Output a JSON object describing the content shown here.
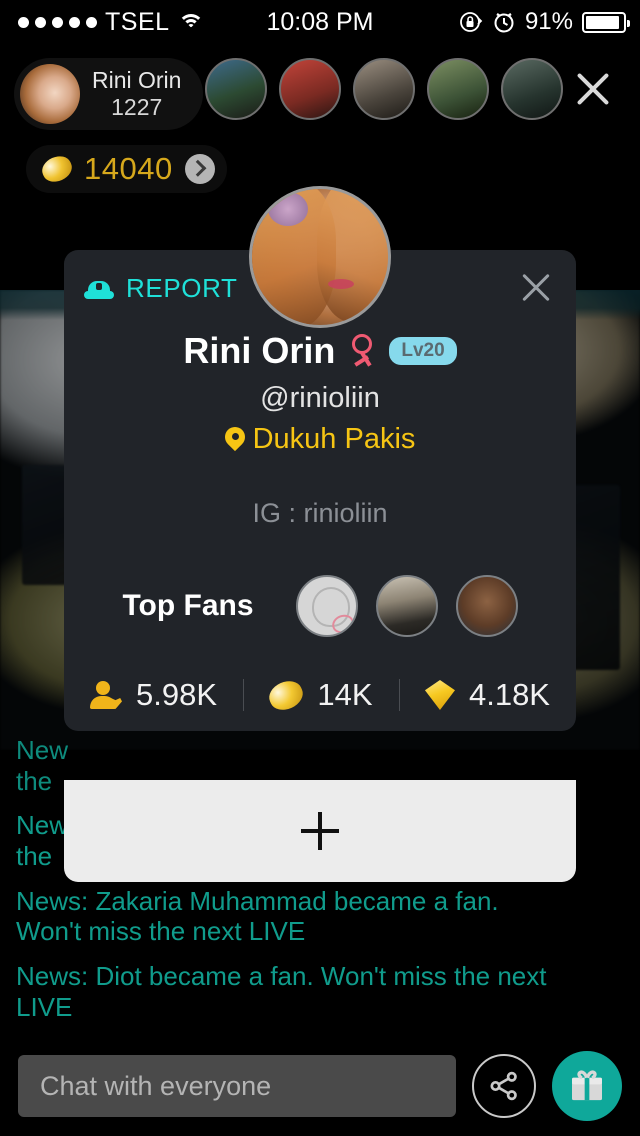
{
  "status_bar": {
    "signal_dots": 5,
    "carrier": "TSEL",
    "wifi_icon": "wifi-icon",
    "time": "10:08 PM",
    "lock_icon": "rotation-lock-icon",
    "alarm_icon": "alarm-clock-icon",
    "battery_percent": "91%",
    "battery_level": 91
  },
  "host_bar": {
    "avatar_name": "host-avatar",
    "name": "Rini Orin",
    "viewer_id": "1227",
    "close_label": "close-broadcast",
    "stories_count": 5
  },
  "coin_bar": {
    "coin_icon": "coin-icon",
    "value": "14040",
    "arrow_icon": "chevron-right-icon"
  },
  "profile_card": {
    "report_label": "REPORT",
    "report_icon": "police-cap-icon",
    "close_icon": "close-icon",
    "avatar_name": "profile-avatar",
    "display_name": "Rini Orin",
    "gender_icon": "female-gender-icon",
    "level_badge": "Lv20",
    "handle": "@rinioliin",
    "location_icon": "location-pin-icon",
    "location": "Dukuh Pakis",
    "ig_line": "IG : rinioliin",
    "top_fans_label": "Top Fans",
    "top_fans": [
      {
        "name": "top-fan-1"
      },
      {
        "name": "top-fan-2"
      },
      {
        "name": "top-fan-3"
      }
    ],
    "stats": [
      {
        "icon": "fan-person-icon",
        "value": "5.98K"
      },
      {
        "icon": "coin-icon",
        "value": "14K"
      },
      {
        "icon": "diamond-icon",
        "value": "4.18K"
      }
    ]
  },
  "sheet": {
    "plus_icon": "plus-icon"
  },
  "chat_feed": {
    "messages": [
      {
        "text": "New",
        "second_line": "the",
        "truncated": true
      },
      {
        "text": "New",
        "second_line": "the",
        "truncated": true
      },
      {
        "text": "News: Zakaria Muhammad became a fan. Won't miss the next LIVE",
        "truncated": false
      },
      {
        "text": "News: Diot  became a fan. Won't miss the next LIVE",
        "truncated": false
      }
    ]
  },
  "bottom_bar": {
    "chat_placeholder": "Chat with everyone",
    "share_icon": "share-icon",
    "gift_icon": "gift-icon"
  },
  "colors": {
    "card_bg": "#212429",
    "report_cyan": "#1fe0d8",
    "gold": "#f6c514",
    "coin_gold": "#d6a81c",
    "chat_teal": "#0e8b7d",
    "gift_teal": "#0fa89a",
    "level_blue": "#86d9ec",
    "gender_pink": "#ef5a72",
    "sheet_bg": "#ececec"
  }
}
